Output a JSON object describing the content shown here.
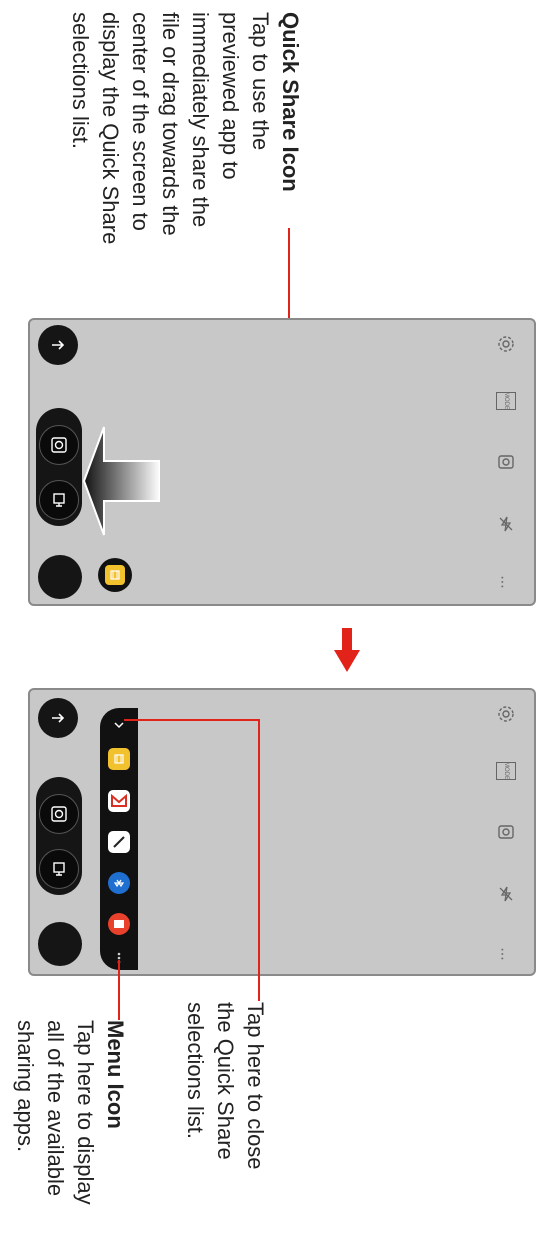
{
  "callouts": {
    "quick_share": {
      "heading": "Quick Share Icon",
      "lines": [
        "Tap to use the",
        "previewed app to",
        "immediately share the",
        "file or drag towards the",
        "center of the screen to",
        "display the Quick Share",
        "selections list."
      ]
    },
    "close": {
      "lines": [
        "Tap here to close",
        "the Quick Share",
        "selections list."
      ]
    },
    "menu": {
      "heading": "Menu Icon",
      "lines": [
        "Tap here to display",
        "all of the available",
        "sharing apps."
      ]
    }
  },
  "camera_ui": {
    "mode_label": "MODE",
    "more_glyph": "...",
    "icons": [
      "settings-icon",
      "mode-icon",
      "switch-camera-icon",
      "flash-off-icon",
      "more-icon"
    ]
  },
  "quick_share_apps": [
    "gallery-app-icon",
    "gmail-app-icon",
    "memo-app-icon",
    "bluetooth-app-icon",
    "email-app-icon"
  ],
  "colors": {
    "accent_red": "#e2231a",
    "quick_share_yellow": "#f2c12e",
    "screen_bg": "#c8c8c8"
  }
}
